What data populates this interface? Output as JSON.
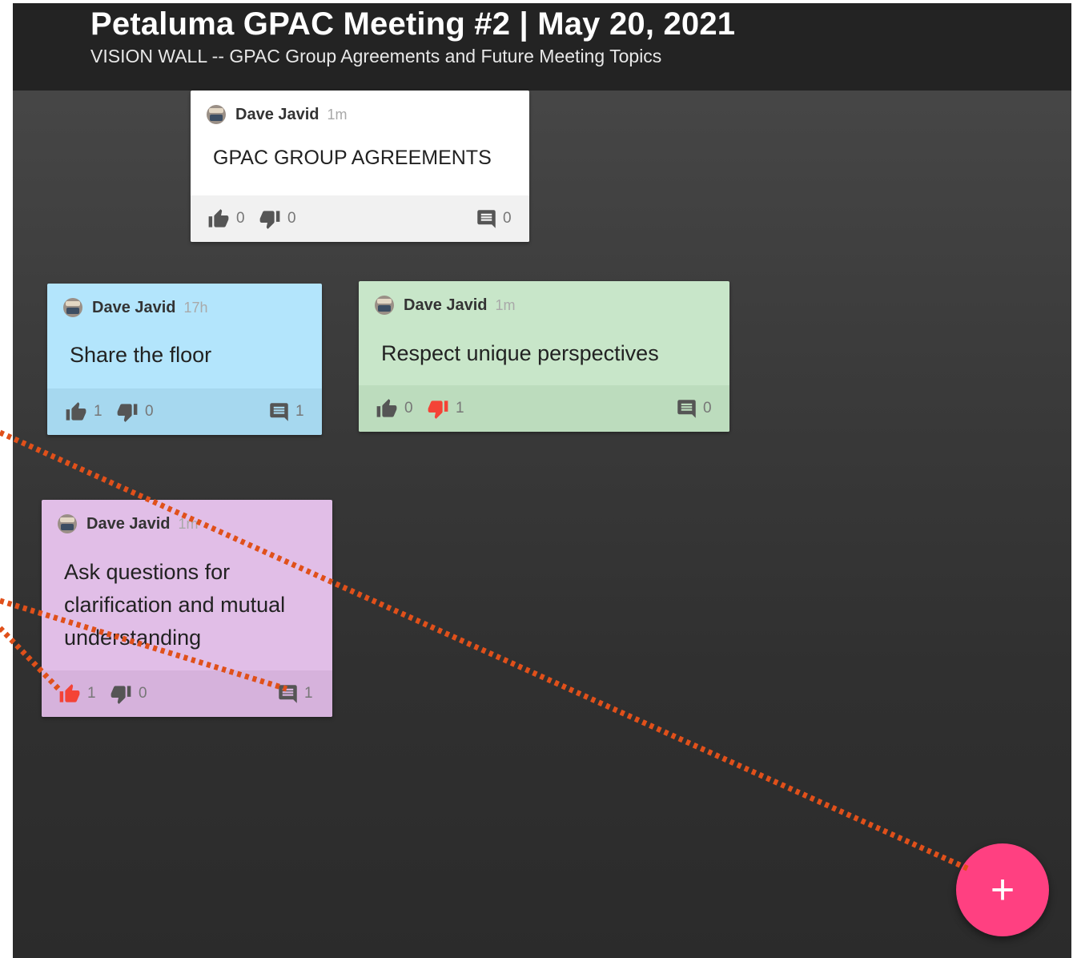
{
  "header": {
    "title": "Petaluma GPAC Meeting #2 | May 20, 2021",
    "subtitle": "VISION WALL -- GPAC Group Agreements and Future Meeting Topics"
  },
  "cards": [
    {
      "author": "Dave Javid",
      "time": "1m",
      "text": "GPAC GROUP AGREEMENTS",
      "likes": "0",
      "dislikes": "0",
      "comments": "0",
      "color": "#ffffff",
      "liked": false,
      "disliked": false
    },
    {
      "author": "Dave Javid",
      "time": "17h",
      "text": "Share the floor",
      "likes": "1",
      "dislikes": "0",
      "comments": "1",
      "color": "#b3e5fc",
      "liked": false,
      "disliked": false
    },
    {
      "author": "Dave Javid",
      "time": "1m",
      "text": "Respect unique perspectives",
      "likes": "0",
      "dislikes": "1",
      "comments": "0",
      "color": "#c8e6c9",
      "liked": false,
      "disliked": true
    },
    {
      "author": "Dave Javid",
      "time": "1m",
      "text": "Ask questions for clarification and mutual understanding",
      "likes": "1",
      "dislikes": "0",
      "comments": "1",
      "color": "#e1bee7",
      "liked": true,
      "disliked": false
    }
  ],
  "fab": {
    "label": "+",
    "color": "#ff4081"
  },
  "icons": {
    "like": "thumb-up-icon",
    "dislike": "thumb-down-icon",
    "comment": "comment-icon",
    "avatar": "avatar-icon",
    "add": "plus-icon"
  },
  "colors": {
    "header_bg": "#232323",
    "active_vote": "#f44336",
    "annotation": "#e0501a",
    "fab": "#ff4081"
  }
}
